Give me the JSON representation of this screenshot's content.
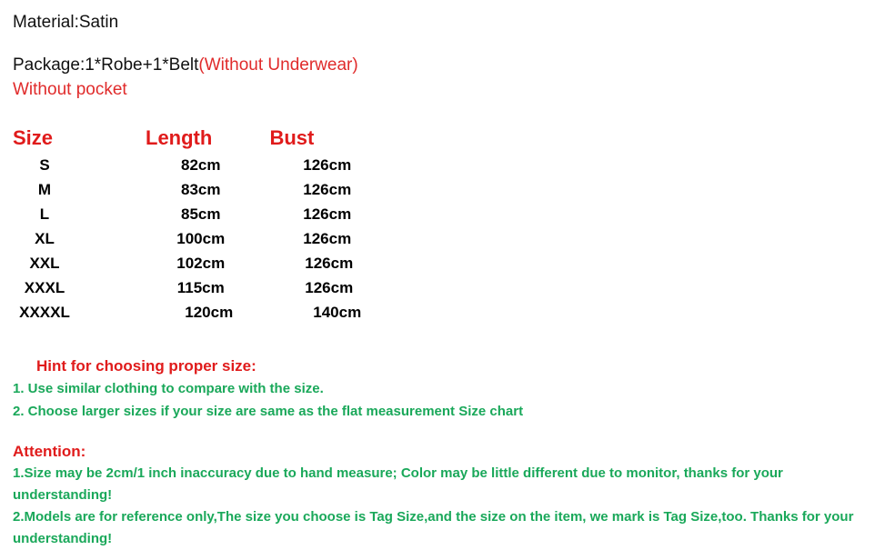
{
  "colors": {
    "red": "#e01b1b",
    "green": "#1aa85a",
    "black": "#000000",
    "background": "#ffffff"
  },
  "intro": {
    "material": "Material:Satin",
    "package_black": "Package:1*Robe+1*Belt",
    "package_red": "(Without Underwear)",
    "pocket": "Without pocket"
  },
  "chart_data": {
    "type": "table",
    "title": "Size chart",
    "columns": [
      "Size",
      "Length",
      "Bust"
    ],
    "rows": [
      {
        "size": "S",
        "length": "82cm",
        "bust": "126cm"
      },
      {
        "size": "M",
        "length": "83cm",
        "bust": "126cm"
      },
      {
        "size": "L",
        "length": "85cm",
        "bust": "126cm"
      },
      {
        "size": "XL",
        "length": "100cm",
        "bust": "126cm"
      },
      {
        "size": "XXL",
        "length": "102cm",
        "bust": "126cm"
      },
      {
        "size": "XXXL",
        "length": "115cm",
        "bust": "126cm"
      },
      {
        "size": "XXXXL",
        "length": "120cm",
        "bust": "140cm"
      }
    ]
  },
  "size_table": {
    "headers": {
      "size": "Size",
      "length": "Length",
      "bust": "Bust"
    },
    "rows": [
      {
        "size": "S",
        "length": "82cm",
        "bust": "126cm"
      },
      {
        "size": "M",
        "length": "83cm",
        "bust": "126cm"
      },
      {
        "size": "L",
        "length": "85cm",
        "bust": "126cm"
      },
      {
        "size": "XL",
        "length": "100cm",
        "bust": "126cm"
      },
      {
        "size": "XXL",
        "length": "102cm",
        "bust": "126cm"
      },
      {
        "size": "XXXL",
        "length": "115cm",
        "bust": "126cm"
      },
      {
        "size": "XXXXL",
        "length": "120cm",
        "bust": "140cm"
      }
    ]
  },
  "hint": {
    "title": "Hint for choosing proper size:",
    "items": [
      "1. Use similar clothing to compare with the size.",
      "2. Choose larger sizes if your size are same as the flat measurement Size chart"
    ]
  },
  "attention": {
    "title": "Attention:",
    "items": [
      "1.Size may be 2cm/1 inch inaccuracy due to hand measure; Color may be little different   due to monitor, thanks for your understanding!",
      "2.Models are for reference only,The size you choose is Tag Size,and the size on the item,  we mark is Tag Size,too. Thanks for your understanding!"
    ]
  }
}
